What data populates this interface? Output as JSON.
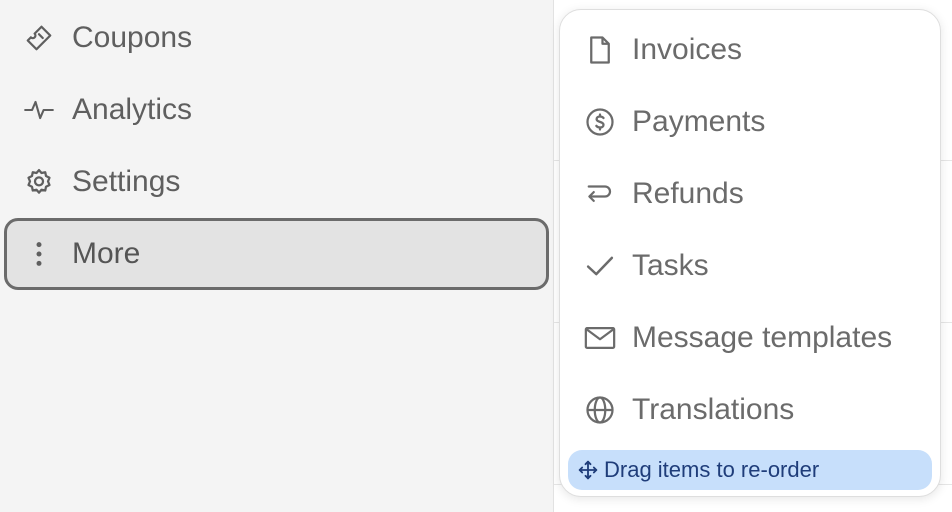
{
  "sidebar": {
    "items": [
      {
        "label": "Coupons",
        "icon": "ticket-icon"
      },
      {
        "label": "Analytics",
        "icon": "pulse-icon"
      },
      {
        "label": "Settings",
        "icon": "gear-icon"
      },
      {
        "label": "More",
        "icon": "more-vertical-icon",
        "active": true
      }
    ]
  },
  "more_menu": {
    "items": [
      {
        "label": "Invoices",
        "icon": "document-icon"
      },
      {
        "label": "Payments",
        "icon": "dollar-circle-icon"
      },
      {
        "label": "Refunds",
        "icon": "return-arrow-icon"
      },
      {
        "label": "Tasks",
        "icon": "check-icon"
      },
      {
        "label": "Message templates",
        "icon": "envelope-icon"
      },
      {
        "label": "Translations",
        "icon": "globe-icon"
      }
    ],
    "hint": {
      "label": "Drag items to re-order",
      "icon": "move-icon"
    }
  },
  "colors": {
    "sidebar_bg": "#f4f4f4",
    "active_bg": "#e3e3e3",
    "active_border": "#6b6b6b",
    "text": "#5f5f5f",
    "hint_bg": "#c7dffb",
    "hint_text": "#1f3d7a"
  }
}
